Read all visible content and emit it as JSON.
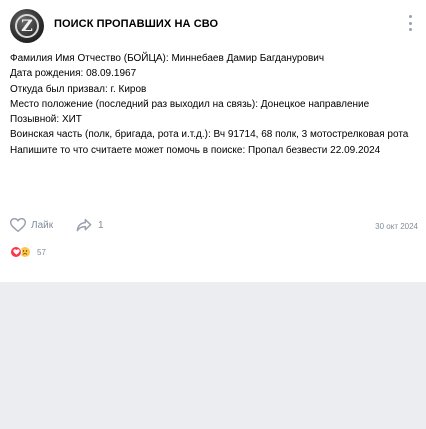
{
  "post": {
    "group_name": "ПОИСК ПРОПАВШИХ НА СВО",
    "avatar_icon": "group-logo-icon",
    "lines": [
      "Фамилия Имя Отчество (БОЙЦА): Миннебаев Дамир Багданурович",
      "Дата рождения: 08.09.1967",
      "Откуда был призвал: г. Киров",
      "Место положение (последний раз выходил на связь): Донецкое направление",
      "Позывной: ХИТ",
      "Воинская часть (полк, бригада, рота и.т.д.): Вч 91714, 68 полк, 3 мотострелковая рота",
      "Напишите то что считаете может помочь в поиске: Пропал безвести 22.09.2024"
    ],
    "date": "30 окт 2024"
  },
  "actions": {
    "like_label": "Лайк",
    "share_count": "1"
  },
  "reactions": {
    "icons": [
      "heart-reaction-icon",
      "sad-reaction-icon"
    ],
    "count": "57"
  },
  "colors": {
    "muted": "#818c99",
    "icon": "#99a2ad",
    "heart": "#ff3347",
    "sad": "#ffc64d",
    "background": "#ebedf0"
  }
}
